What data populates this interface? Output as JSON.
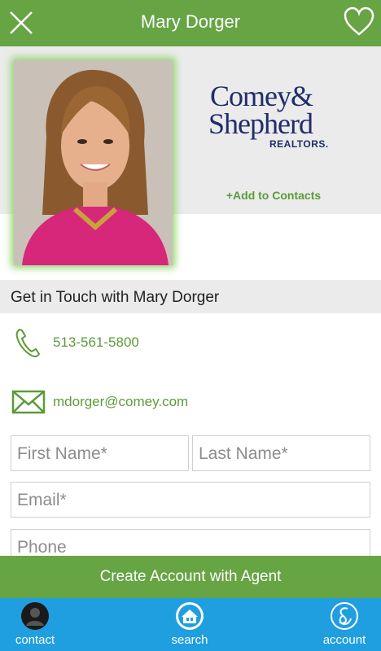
{
  "header": {
    "title": "Mary Dorger"
  },
  "agent": {
    "brand_line1": "Comey&",
    "brand_line2": "Shepherd",
    "brand_line3": "REALTORS.",
    "add_contacts": "+Add to Contacts"
  },
  "section": {
    "title": "Get in Touch with Mary Dorger"
  },
  "contact": {
    "phone": "513-561-5800",
    "email": "mdorger@comey.com"
  },
  "form": {
    "first_name_placeholder": "First Name*",
    "last_name_placeholder": "Last Name*",
    "email_placeholder": "Email*",
    "phone_placeholder": "Phone"
  },
  "cta": {
    "label": "Create Account with Agent"
  },
  "tabs": [
    {
      "label": "contact",
      "icon": "contact-avatar-icon"
    },
    {
      "label": "search",
      "icon": "house-search-icon"
    },
    {
      "label": "account",
      "icon": "account-logo-icon"
    }
  ],
  "colors": {
    "header_green": "#66a444",
    "accent_green": "#5c9b38",
    "tab_blue": "#1f9ee0",
    "brand_navy": "#1f2d6b"
  }
}
